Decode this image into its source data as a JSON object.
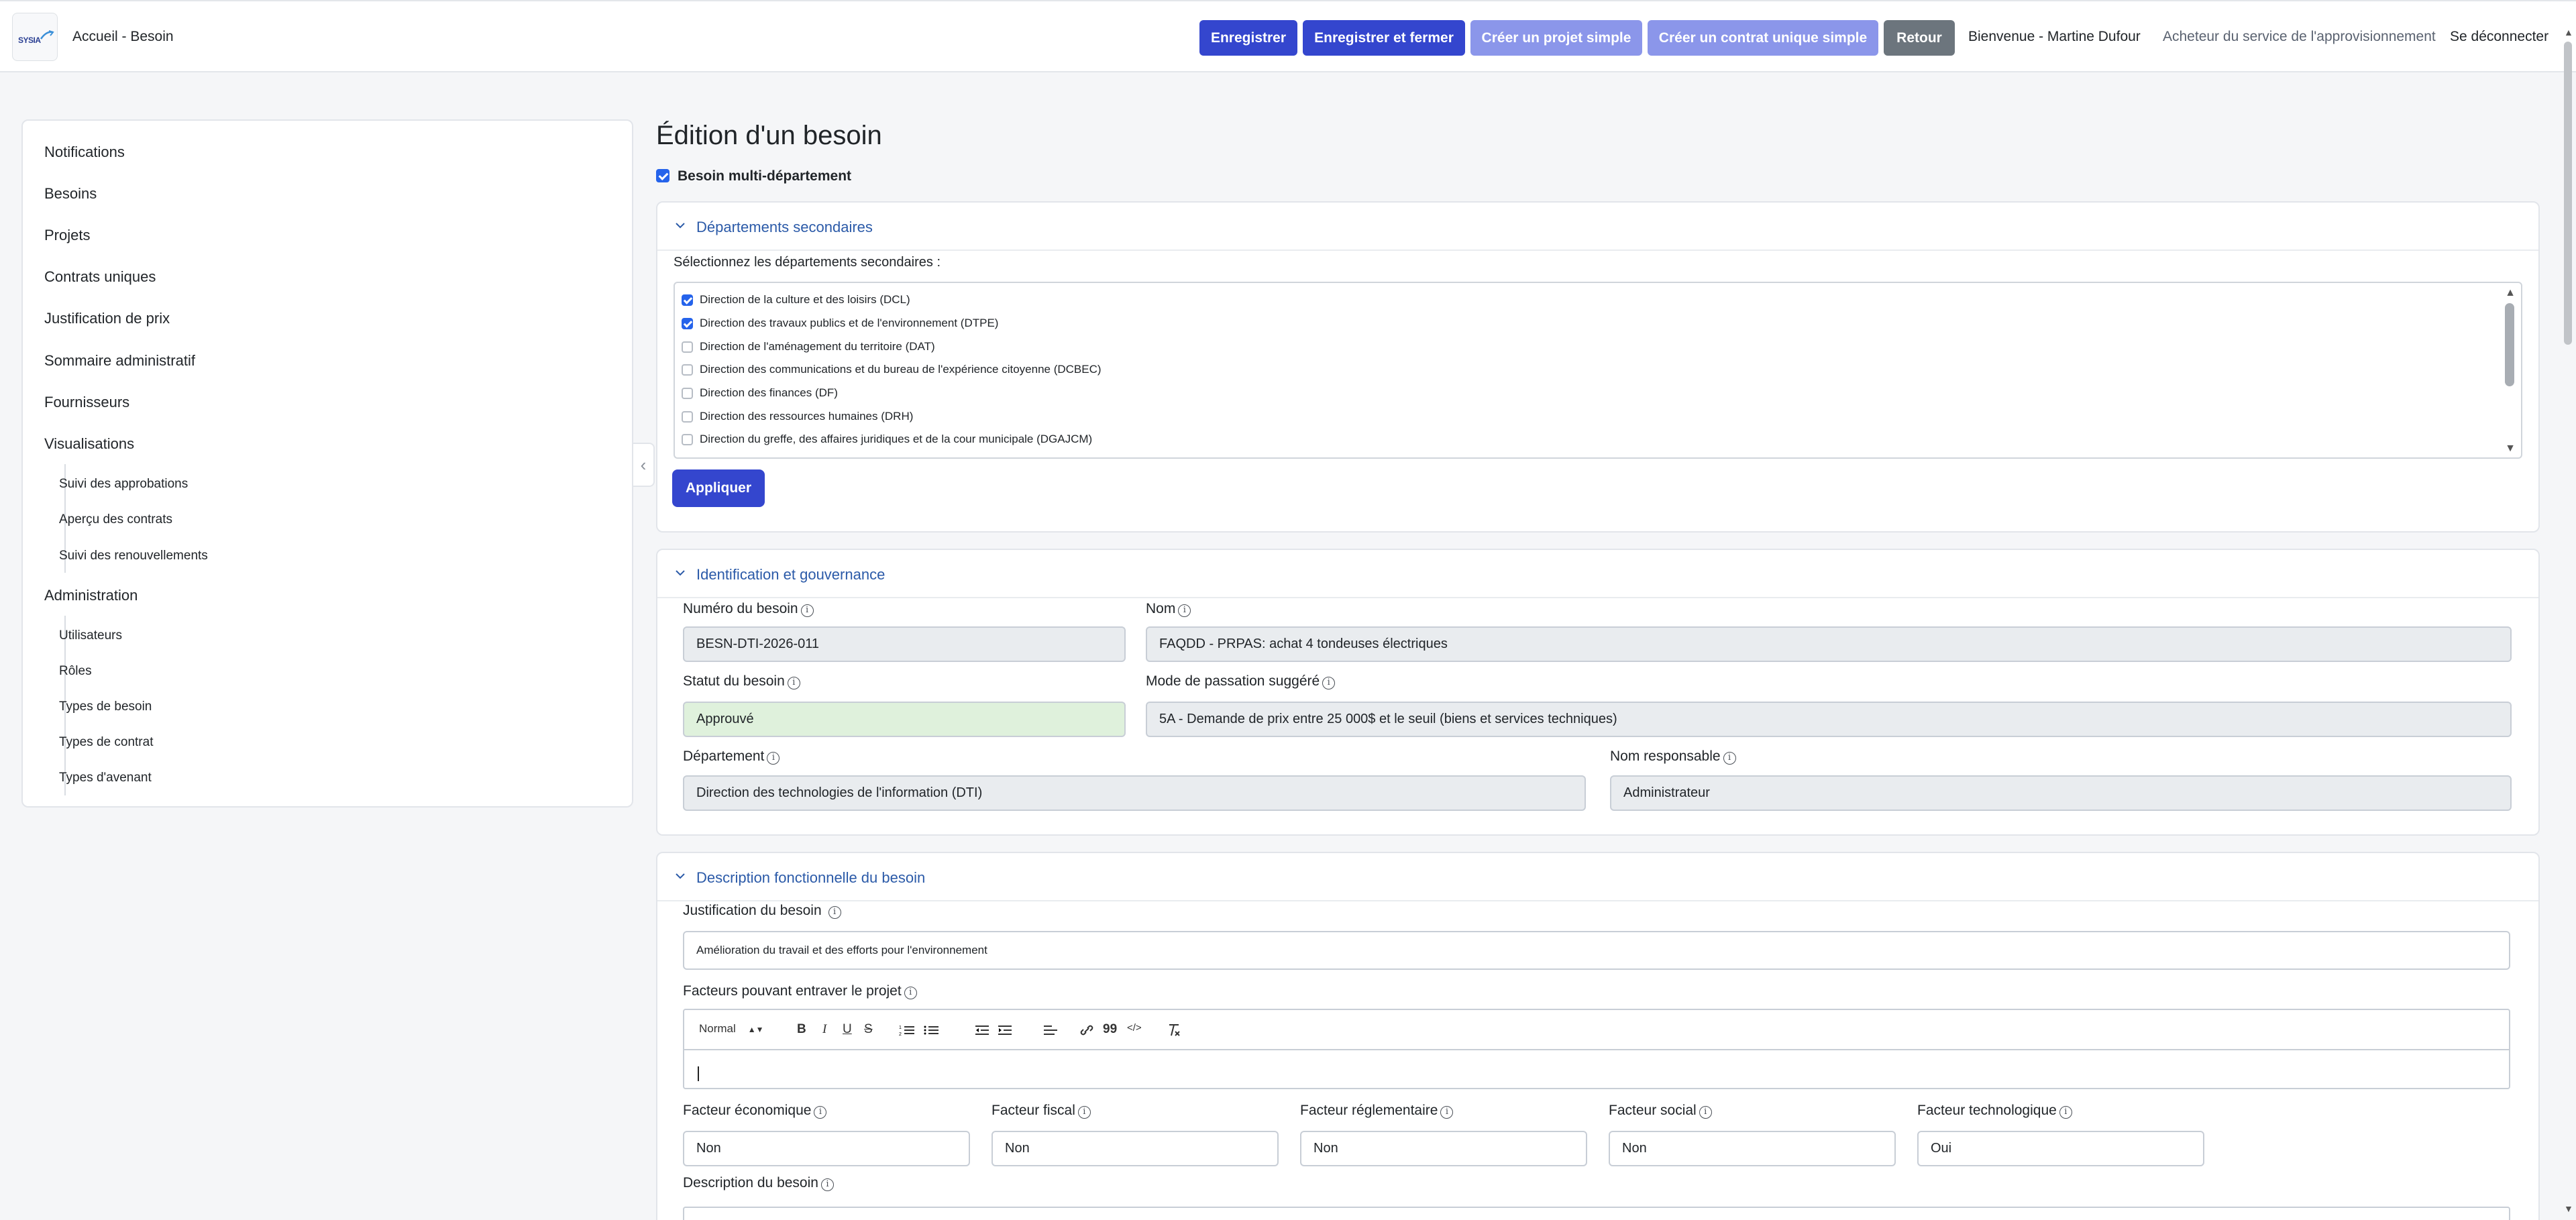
{
  "header": {
    "logo_text": "SYSIA",
    "breadcrumb": "Accueil - Besoin",
    "buttons": {
      "save": "Enregistrer",
      "save_close": "Enregistrer et fermer",
      "create_project": "Créer un projet simple",
      "create_contract": "Créer un contrat unique simple",
      "back": "Retour"
    },
    "welcome": "Bienvenue - Martine Dufour",
    "role": "Acheteur du service de l'approvisionnement",
    "logout": "Se déconnecter"
  },
  "sidebar": {
    "items": [
      "Notifications",
      "Besoins",
      "Projets",
      "Contrats uniques",
      "Justification de prix",
      "Sommaire administratif",
      "Fournisseurs",
      "Visualisations",
      "Administration"
    ],
    "visualisations": [
      "Suivi des approbations",
      "Aperçu des contrats",
      "Suivi des renouvellements"
    ],
    "administration": [
      "Utilisateurs",
      "Rôles",
      "Types de besoin",
      "Types de contrat",
      "Types d'avenant"
    ]
  },
  "page": {
    "title": "Édition d'un besoin",
    "multi_dept_label": "Besoin multi-département"
  },
  "secondary": {
    "title": "Départements secondaires",
    "select_label": "Sélectionnez les départements secondaires :",
    "options": [
      {
        "label": "Direction de la culture et des loisirs (DCL)",
        "checked": true
      },
      {
        "label": "Direction des travaux publics et de l'environnement (DTPE)",
        "checked": true
      },
      {
        "label": "Direction de l'aménagement du territoire (DAT)",
        "checked": false
      },
      {
        "label": "Direction des communications et du bureau de l'expérience citoyenne (DCBEC)",
        "checked": false
      },
      {
        "label": "Direction des finances (DF)",
        "checked": false
      },
      {
        "label": "Direction des ressources humaines (DRH)",
        "checked": false
      },
      {
        "label": "Direction du greffe, des affaires juridiques et de la cour municipale (DGAJCM)",
        "checked": false
      }
    ],
    "apply": "Appliquer"
  },
  "identification": {
    "title": "Identification et gouvernance",
    "numero_label": "Numéro du besoin",
    "numero": "BESN-DTI-2026-011",
    "nom_label": "Nom",
    "nom": "FAQDD - PRPAS: achat 4 tondeuses électriques",
    "statut_label": "Statut du besoin",
    "statut": "Approuvé",
    "mode_label": "Mode de passation suggéré",
    "mode": "5A - Demande de prix entre 25 000$ et le seuil (biens et services techniques)",
    "departement_label": "Département",
    "departement": "Direction des technologies de l'information (DTI)",
    "responsable_label": "Nom responsable",
    "responsable": "Administrateur"
  },
  "description": {
    "title": "Description fonctionnelle du besoin",
    "justification_label": "Justification du besoin",
    "justification": "Amélioration du travail et des efforts pour l'environnement",
    "facteurs_label": "Facteurs pouvant entraver le projet",
    "editor_format": "Normal",
    "toolbar": {
      "bold": "B",
      "italic": "I",
      "underline": "U",
      "strike": "S",
      "quote": "99",
      "code": "</>"
    },
    "facteurs": [
      {
        "label": "Facteur économique",
        "value": "Non"
      },
      {
        "label": "Facteur fiscal",
        "value": "Non"
      },
      {
        "label": "Facteur réglementaire",
        "value": "Non"
      },
      {
        "label": "Facteur social",
        "value": "Non"
      },
      {
        "label": "Facteur technologique",
        "value": "Oui"
      }
    ],
    "description_label": "Description du besoin"
  },
  "icons": [
    "logo-icon",
    "chevron-down-icon",
    "chevron-left-icon",
    "info-icon",
    "ordered-list-icon",
    "bullet-list-icon",
    "outdent-icon",
    "indent-icon",
    "align-icon",
    "link-icon",
    "clear-format-icon"
  ]
}
